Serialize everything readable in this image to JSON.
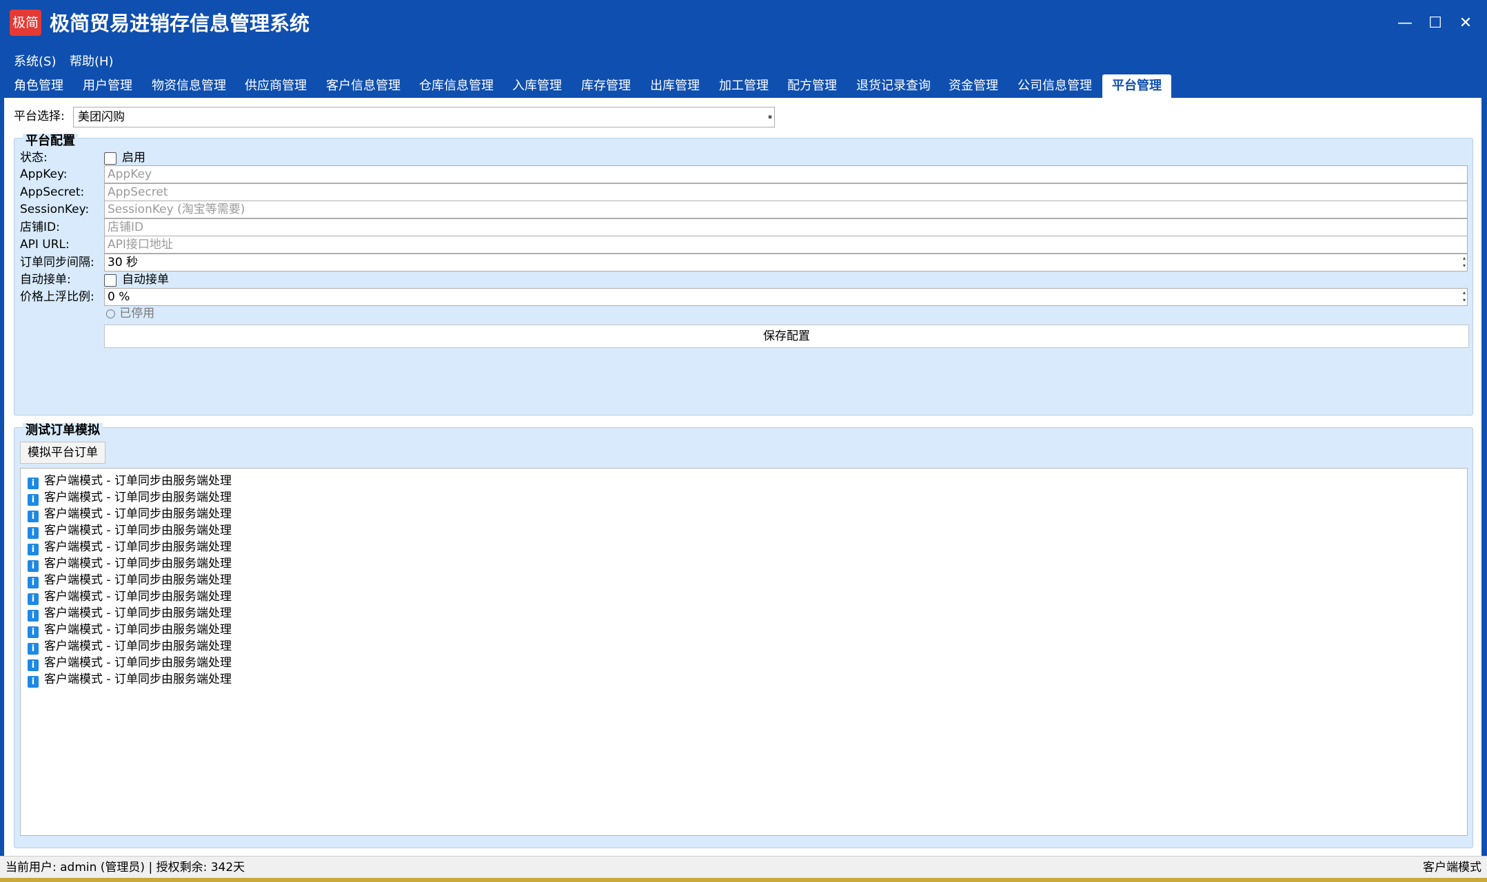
{
  "window": {
    "logo_text": "极简",
    "title": "极简贸易进销存信息管理系统",
    "controls": {
      "minimize": "—",
      "maximize": "☐",
      "close": "✕"
    }
  },
  "menu": {
    "system": "系统(S)",
    "help": "帮助(H)"
  },
  "tabs": [
    "角色管理",
    "用户管理",
    "物资信息管理",
    "供应商管理",
    "客户信息管理",
    "仓库信息管理",
    "入库管理",
    "库存管理",
    "出库管理",
    "加工管理",
    "配方管理",
    "退货记录查询",
    "资金管理",
    "公司信息管理",
    "平台管理"
  ],
  "active_tab": "平台管理",
  "platform": {
    "label": "平台选择:",
    "selected": "美团闪购"
  },
  "config": {
    "title": "平台配置",
    "status_label": "状态:",
    "status_checkbox_label": "启用",
    "status_checked": false,
    "appkey_label": "AppKey:",
    "appkey_placeholder": "AppKey",
    "appsecret_label": "AppSecret:",
    "appsecret_placeholder": "AppSecret",
    "sessionkey_label": "SessionKey:",
    "sessionkey_placeholder": "SessionKey (淘宝等需要)",
    "shopid_label": "店铺ID:",
    "shopid_placeholder": "店铺ID",
    "apiurl_label": "API URL:",
    "apiurl_placeholder": "API接口地址",
    "sync_interval_label": "订单同步间隔:",
    "sync_interval_value": "30 秒",
    "auto_accept_label": "自动接单:",
    "auto_accept_checkbox_label": "自动接单",
    "auto_accept_checked": false,
    "price_ratio_label": "价格上浮比例:",
    "price_ratio_value": "0 %",
    "stopped_status": "○ 已停用",
    "save_button": "保存配置"
  },
  "test": {
    "title": "测试订单模拟",
    "simulate_button": "模拟平台订单",
    "log_icon_text": "i",
    "log_entries": [
      "客户端模式 - 订单同步由服务端处理",
      "客户端模式 - 订单同步由服务端处理",
      "客户端模式 - 订单同步由服务端处理",
      "客户端模式 - 订单同步由服务端处理",
      "客户端模式 - 订单同步由服务端处理",
      "客户端模式 - 订单同步由服务端处理",
      "客户端模式 - 订单同步由服务端处理",
      "客户端模式 - 订单同步由服务端处理",
      "客户端模式 - 订单同步由服务端处理",
      "客户端模式 - 订单同步由服务端处理",
      "客户端模式 - 订单同步由服务端处理",
      "客户端模式 - 订单同步由服务端处理",
      "客户端模式 - 订单同步由服务端处理"
    ]
  },
  "statusbar": {
    "left": "当前用户: admin (管理员)  |  授权剩余: 342天",
    "right": "客户端模式"
  },
  "colors": {
    "primary": "#0f4faf",
    "group_background": "#d8eafb",
    "info_icon": "#1e88e5"
  }
}
